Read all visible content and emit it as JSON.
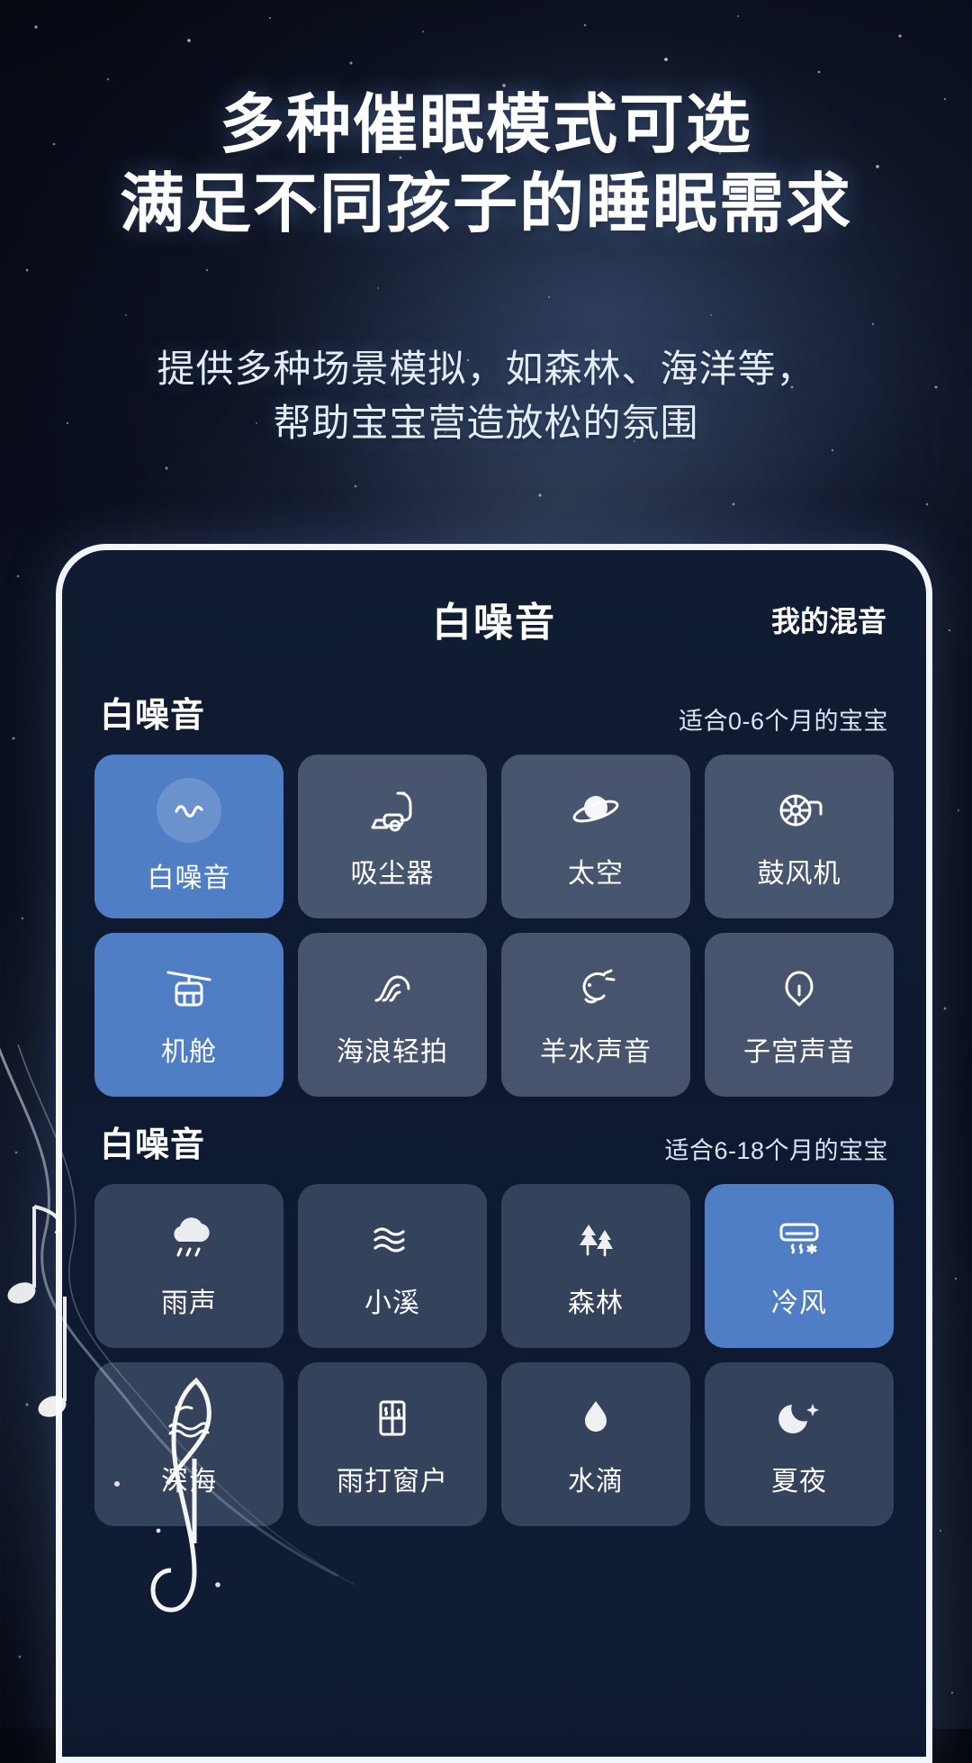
{
  "promo": {
    "headline_line1": "多种催眠模式可选",
    "headline_line2": "满足不同孩子的睡眠需求",
    "subline_line1": "提供多种场景模拟，如森林、海洋等，",
    "subline_line2": "帮助宝宝营造放松的氛围"
  },
  "app": {
    "tab_main": "白噪音",
    "tab_right": "我的混音",
    "sections": [
      {
        "title": "白噪音",
        "note": "适合0-6个月的宝宝",
        "tiles": [
          {
            "label": "白噪音",
            "icon": "wave-circle-icon",
            "state": "active"
          },
          {
            "label": "吸尘器",
            "icon": "vacuum-icon",
            "state": "normal"
          },
          {
            "label": "太空",
            "icon": "planet-icon",
            "state": "normal"
          },
          {
            "label": "鼓风机",
            "icon": "blower-icon",
            "state": "normal"
          },
          {
            "label": "机舱",
            "icon": "cabin-icon",
            "state": "active"
          },
          {
            "label": "海浪轻拍",
            "icon": "wave-icon",
            "state": "normal"
          },
          {
            "label": "羊水声音",
            "icon": "fetus-icon",
            "state": "normal"
          },
          {
            "label": "子宫声音",
            "icon": "womb-icon",
            "state": "normal"
          }
        ]
      },
      {
        "title": "白噪音",
        "note": "适合6-18个月的宝宝",
        "tiles": [
          {
            "label": "雨声",
            "icon": "rain-cloud-icon",
            "state": "normal"
          },
          {
            "label": "小溪",
            "icon": "stream-icon",
            "state": "normal"
          },
          {
            "label": "森林",
            "icon": "forest-icon",
            "state": "normal"
          },
          {
            "label": "冷风",
            "icon": "air-conditioner-icon",
            "state": "active"
          },
          {
            "label": "深海",
            "icon": "deep-sea-icon",
            "state": "normal"
          },
          {
            "label": "雨打窗户",
            "icon": "rain-window-icon",
            "state": "normal"
          },
          {
            "label": "水滴",
            "icon": "water-drop-icon",
            "state": "normal"
          },
          {
            "label": "夏夜",
            "icon": "summer-night-icon",
            "state": "normal"
          }
        ]
      }
    ]
  },
  "colors": {
    "accent": "#4f7ec4",
    "tile": "#98a8c4",
    "phone_bg": "#101c35",
    "text": "#ffffff"
  }
}
